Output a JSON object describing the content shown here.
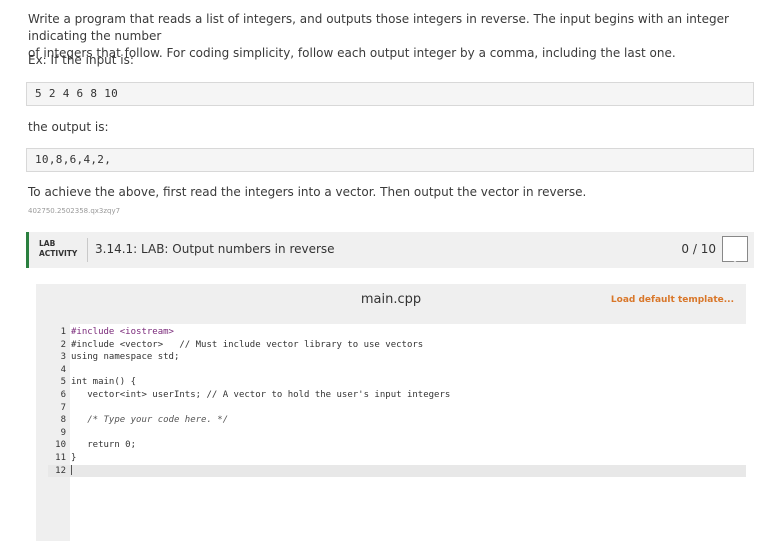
{
  "instructions": {
    "line1": "Write a program that reads a list of integers, and outputs those integers in reverse. The input begins with an integer indicating the number",
    "line2": "of integers that follow. For coding simplicity, follow each output integer by a comma, including the last one.",
    "example_label": "Ex: If the input is:",
    "example_input": "5 2 4 6 8 10",
    "output_label": "the output is:",
    "example_output": "10,8,6,4,2,",
    "hint": "To achieve the above, first read the integers into a vector. Then output the vector in reverse.",
    "id_text": "402750.2502358.qx3zqy7"
  },
  "lab": {
    "tag_line1": "LAB",
    "tag_line2": "ACTIVITY",
    "title": "3.14.1: LAB: Output numbers in reverse",
    "score": "0 / 10",
    "accent_color": "#2a7f3f"
  },
  "editor": {
    "filename": "main.cpp",
    "load_template": "Load default template...",
    "lines": [
      {
        "n": "1",
        "text": "#include <iostream>"
      },
      {
        "n": "2",
        "text": "#include <vector>   // Must include vector library to use vectors"
      },
      {
        "n": "3",
        "text": "using namespace std;"
      },
      {
        "n": "4",
        "text": ""
      },
      {
        "n": "5",
        "text": "int main() {"
      },
      {
        "n": "6",
        "text": "   vector<int> userInts; // A vector to hold the user's input integers"
      },
      {
        "n": "7",
        "text": ""
      },
      {
        "n": "8",
        "text": "   /* Type your code here. */"
      },
      {
        "n": "9",
        "text": ""
      },
      {
        "n": "10",
        "text": "   return 0;"
      },
      {
        "n": "11",
        "text": "}"
      },
      {
        "n": "12",
        "text": ""
      }
    ]
  }
}
